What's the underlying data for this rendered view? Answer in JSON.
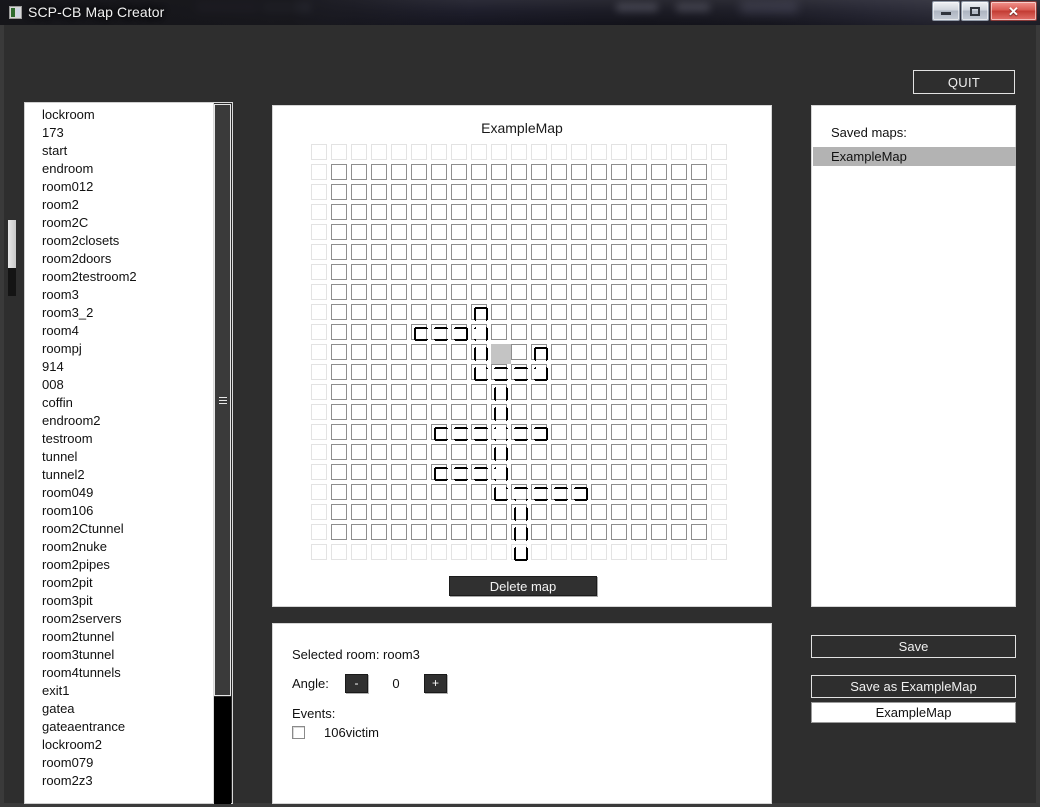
{
  "window": {
    "title": "SCP-CB Map Creator",
    "minimize_label": "minimize",
    "maximize_label": "maximize",
    "close_label": "✕"
  },
  "toolbar": {
    "quit_label": "QUIT"
  },
  "room_list": {
    "items": [
      "lockroom",
      "173",
      "start",
      "endroom",
      "room012",
      "room2",
      "room2C",
      "room2closets",
      "room2doors",
      "room2testroom2",
      "room3",
      "room3_2",
      "room4",
      "roompj",
      "914",
      "008",
      "coffin",
      "endroom2",
      "testroom",
      "tunnel",
      "tunnel2",
      "room049",
      "room106",
      "room2Ctunnel",
      "room2nuke",
      "room2pipes",
      "room2pit",
      "room3pit",
      "room2servers",
      "room2tunnel",
      "room3tunnel",
      "room4tunnels",
      "exit1",
      "gatea",
      "gateaentrance",
      "lockroom2",
      "room079",
      "room2z3"
    ]
  },
  "map": {
    "title": "ExampleMap",
    "delete_label": "Delete map",
    "grid_cols": 21,
    "grid_rows": 21,
    "selected_cell": {
      "col": 10,
      "row": 11
    },
    "rooms": [
      {
        "col": 9,
        "row": 9,
        "doors": [
          "s"
        ]
      },
      {
        "col": 6,
        "row": 10,
        "doors": [
          "e"
        ]
      },
      {
        "col": 7,
        "row": 10,
        "doors": [
          "w",
          "e"
        ]
      },
      {
        "col": 8,
        "row": 10,
        "doors": [
          "w"
        ]
      },
      {
        "col": 9,
        "row": 10,
        "doors": [
          "n",
          "s",
          "w"
        ]
      },
      {
        "col": 9,
        "row": 11,
        "doors": [
          "n",
          "s"
        ]
      },
      {
        "col": 12,
        "row": 11,
        "doors": [
          "s"
        ]
      },
      {
        "col": 9,
        "row": 12,
        "doors": [
          "n",
          "e"
        ]
      },
      {
        "col": 10,
        "row": 12,
        "doors": [
          "w",
          "e"
        ]
      },
      {
        "col": 11,
        "row": 12,
        "doors": [
          "w",
          "e"
        ]
      },
      {
        "col": 12,
        "row": 12,
        "doors": [
          "n",
          "w"
        ]
      },
      {
        "col": 10,
        "row": 13,
        "doors": [
          "n",
          "s"
        ]
      },
      {
        "col": 10,
        "row": 14,
        "doors": [
          "n",
          "s"
        ]
      },
      {
        "col": 7,
        "row": 15,
        "doors": [
          "e"
        ]
      },
      {
        "col": 8,
        "row": 15,
        "doors": [
          "w",
          "e"
        ]
      },
      {
        "col": 9,
        "row": 15,
        "doors": [
          "w",
          "e"
        ]
      },
      {
        "col": 10,
        "row": 15,
        "doors": [
          "n",
          "e",
          "s",
          "w"
        ]
      },
      {
        "col": 11,
        "row": 15,
        "doors": [
          "w",
          "e"
        ]
      },
      {
        "col": 12,
        "row": 15,
        "doors": [
          "w"
        ]
      },
      {
        "col": 10,
        "row": 16,
        "doors": [
          "n",
          "s"
        ]
      },
      {
        "col": 7,
        "row": 17,
        "doors": [
          "e"
        ]
      },
      {
        "col": 8,
        "row": 17,
        "doors": [
          "w",
          "e"
        ]
      },
      {
        "col": 9,
        "row": 17,
        "doors": [
          "w",
          "e"
        ]
      },
      {
        "col": 10,
        "row": 17,
        "doors": [
          "n",
          "w",
          "s"
        ]
      },
      {
        "col": 10,
        "row": 18,
        "doors": [
          "n",
          "e"
        ]
      },
      {
        "col": 11,
        "row": 18,
        "doors": [
          "w",
          "e",
          "s"
        ]
      },
      {
        "col": 12,
        "row": 18,
        "doors": [
          "w",
          "e"
        ]
      },
      {
        "col": 13,
        "row": 18,
        "doors": [
          "w",
          "e"
        ]
      },
      {
        "col": 14,
        "row": 18,
        "doors": [
          "w"
        ]
      },
      {
        "col": 11,
        "row": 19,
        "doors": [
          "n",
          "s"
        ]
      },
      {
        "col": 11,
        "row": 20,
        "doors": [
          "n",
          "s"
        ]
      },
      {
        "col": 11,
        "row": 21,
        "doors": [
          "n"
        ]
      }
    ]
  },
  "details": {
    "selected_room_label": "Selected room: room3",
    "angle_label": "Angle:",
    "angle_minus": "-",
    "angle_value": "0",
    "angle_plus": "+",
    "events_label": "Events:",
    "events": [
      {
        "name": "106victim",
        "checked": false
      }
    ]
  },
  "saved_maps": {
    "label": "Saved maps:",
    "items": [
      "ExampleMap"
    ],
    "selected": "ExampleMap"
  },
  "actions": {
    "save_label": "Save",
    "save_as_label": "Save as ExampleMap",
    "name_value": "ExampleMap"
  },
  "colors": {
    "window_bg": "#2e2e2e",
    "panel_bg": "#ffffff",
    "selection": "#b3b3b3",
    "grid_line": "#8e8e8e",
    "grid_line_faint": "#e3e3e3",
    "button_dark": "#2e2e2e",
    "room_stroke": "#000000",
    "selected_cell_fill": "#c4c4c4"
  }
}
